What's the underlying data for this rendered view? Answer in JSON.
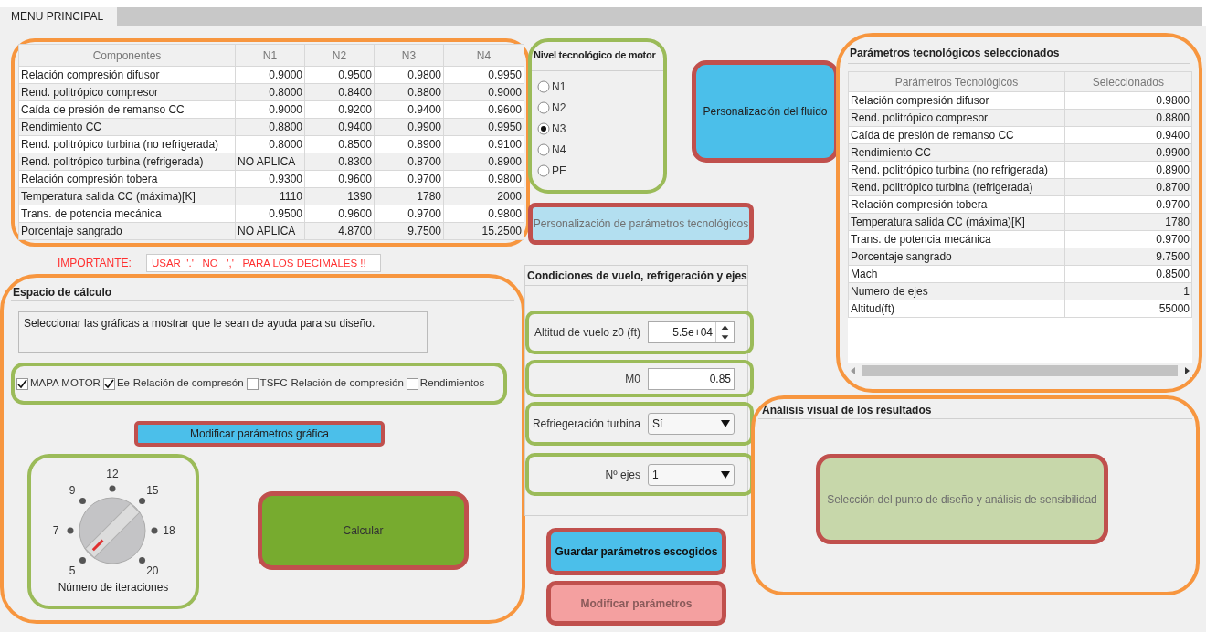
{
  "tab": {
    "label": "MENU PRINCIPAL",
    "selected": true
  },
  "components_table": {
    "columns": [
      "Componentes",
      "N1",
      "N2",
      "N3",
      "N4"
    ],
    "rows": [
      [
        "Relación compresión difusor",
        "0.9000",
        "0.9500",
        "0.9800",
        "0.9950"
      ],
      [
        "Rend. politrópico compresor",
        "0.8000",
        "0.8400",
        "0.8800",
        "0.9000"
      ],
      [
        "Caída de presión de remanso CC",
        "0.9000",
        "0.9200",
        "0.9400",
        "0.9600"
      ],
      [
        "Rendimiento CC",
        "0.8800",
        "0.9400",
        "0.9900",
        "0.9950"
      ],
      [
        "Rend. politrópico turbina (no refrigerada)",
        "0.8000",
        "0.8500",
        "0.8900",
        "0.9100"
      ],
      [
        "Rend. politrópico turbina (refrigerada)",
        "NO APLICA",
        "0.8300",
        "0.8700",
        "0.8900"
      ],
      [
        "Relación compresión tobera",
        "0.9300",
        "0.9600",
        "0.9700",
        "0.9800"
      ],
      [
        "Temperatura salida CC (máxima)[K]",
        "1110",
        "1390",
        "1780",
        "2000"
      ],
      [
        "Trans. de potencia mecánica",
        "0.9500",
        "0.9600",
        "0.9700",
        "0.9800"
      ],
      [
        "Porcentaje sangrado",
        "NO APLICA",
        "4.8700",
        "9.7500",
        "15.2500"
      ]
    ]
  },
  "warning": {
    "label": "IMPORTANTE:",
    "message": "USAR  '.'   NO   ','   PARA LOS DECIMALES !!"
  },
  "calc_panel": {
    "title": "Espacio de cálculo",
    "info": "Seleccionar las gráficas a mostrar que le sean de ayuda para su diseño.",
    "checkboxes": [
      {
        "label": "MAPA MOTOR",
        "checked": true
      },
      {
        "label": "Ee-Relación de compresón",
        "checked": true
      },
      {
        "label": "TSFC-Relación de compresión",
        "checked": false
      },
      {
        "label": "Rendimientos",
        "checked": false
      }
    ],
    "graph_button": "Modificar parámetros gráfica",
    "knob": {
      "label": "Número de iteraciones",
      "ticks": [
        "5",
        "7",
        "9",
        "12",
        "15",
        "18",
        "20"
      ]
    },
    "calculate_button": "Calcular"
  },
  "level_group": {
    "title": "Nivel tecnológico de motor",
    "options": [
      {
        "label": "N1",
        "selected": false
      },
      {
        "label": "N2",
        "selected": false
      },
      {
        "label": "N3",
        "selected": true
      },
      {
        "label": "N4",
        "selected": false
      },
      {
        "label": "PE",
        "selected": false
      }
    ]
  },
  "fluid_button": "Personalización del fluido",
  "tech_params_button": {
    "label": "Personalización de parámetros tecnológicos",
    "disabled": true
  },
  "flight_panel": {
    "title": "Condiciones de vuelo, refrigeración y ejes",
    "fields": [
      {
        "kind": "spinner",
        "label": "Altitud de vuelo z0 (ft)",
        "value": "5.5e+04"
      },
      {
        "kind": "text",
        "label": "M0",
        "value": "0.85"
      },
      {
        "kind": "dropdown",
        "label": "Refriegeración turbina",
        "value": "Sí"
      },
      {
        "kind": "dropdown",
        "label": "Nº ejes",
        "value": "1"
      }
    ]
  },
  "save_button": {
    "label": "Guardar parámetros escogidos",
    "disabled": false
  },
  "modify_button": {
    "label": "Modificar parámetros",
    "disabled": true
  },
  "selected_panel": {
    "title": "Parámetros tecnológicos seleccionados",
    "columns": [
      "Parámetros Tecnológicos",
      "Seleccionados"
    ],
    "rows": [
      [
        "Relación compresión difusor",
        "0.9800"
      ],
      [
        "Rend. politrópico compresor",
        "0.8800"
      ],
      [
        "Caída de presión de remanso CC",
        "0.9400"
      ],
      [
        "Rendimiento CC",
        "0.9900"
      ],
      [
        "Rend. politrópico turbina (no refrigerada)",
        "0.8900"
      ],
      [
        "Rend. politrópico turbina (refrigerada)",
        "0.8700"
      ],
      [
        "Relación compresión tobera",
        "0.9700"
      ],
      [
        "Temperatura salida CC (máxima)[K]",
        "1780"
      ],
      [
        "Trans. de potencia mecánica",
        "0.9700"
      ],
      [
        "Porcentaje sangrado",
        "9.7500"
      ],
      [
        "Mach",
        "0.8500"
      ],
      [
        "Numero de ejes",
        "1"
      ],
      [
        "Altitud(ft)",
        "55000"
      ]
    ]
  },
  "analysis_panel": {
    "title": "Análisis visual de los resultados",
    "button": {
      "label": "Selección del punto de diseño y análisis de sensibilidad",
      "disabled": true
    }
  }
}
